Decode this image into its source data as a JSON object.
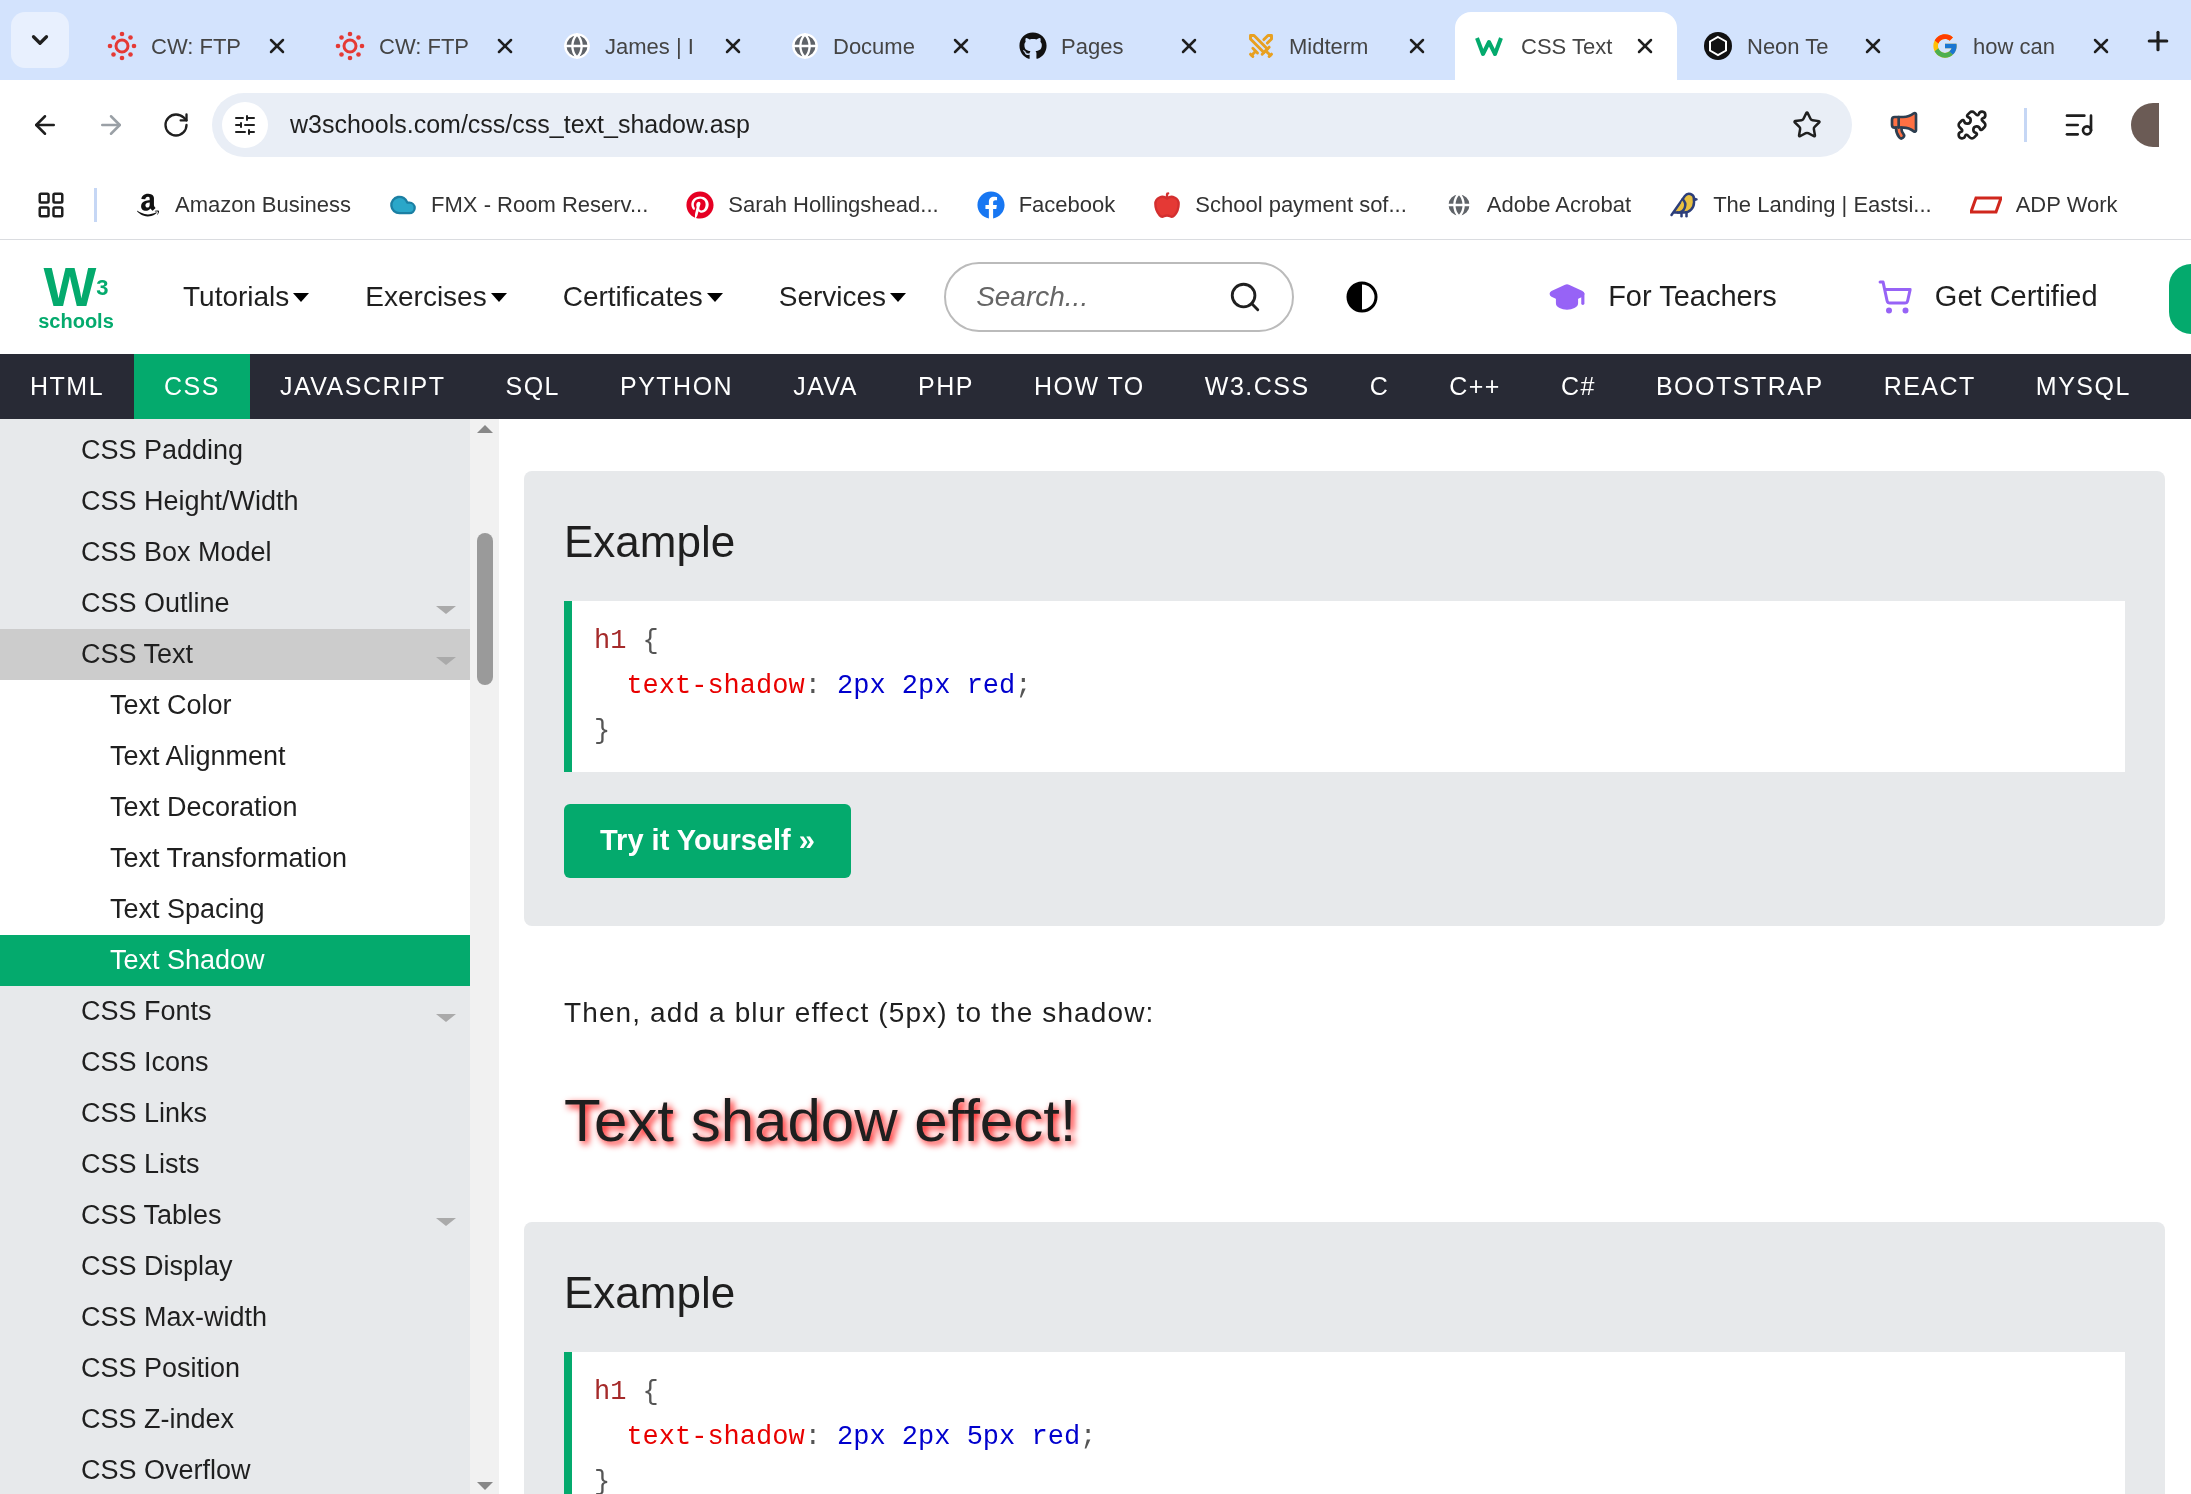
{
  "browser": {
    "tabs": [
      {
        "title": "CW: FTP",
        "kind": "canvas",
        "selected": false
      },
      {
        "title": "CW: FTP",
        "kind": "canvas",
        "selected": false
      },
      {
        "title": "James | I",
        "kind": "globe",
        "selected": false
      },
      {
        "title": "Docume",
        "kind": "globe",
        "selected": false
      },
      {
        "title": "Pages",
        "kind": "github",
        "selected": false
      },
      {
        "title": "Midterm",
        "kind": "swords",
        "selected": false
      },
      {
        "title": "CSS Text",
        "kind": "w3",
        "selected": true
      },
      {
        "title": "Neon Te",
        "kind": "openai",
        "selected": false
      },
      {
        "title": "how can",
        "kind": "google",
        "selected": false
      }
    ],
    "address": "w3schools.com/css/css_text_shadow.asp",
    "bookmarks": [
      {
        "label": "Amazon Business",
        "kind": "amazon"
      },
      {
        "label": "FMX - Room Reserv...",
        "kind": "cloud"
      },
      {
        "label": "Sarah Hollingshead...",
        "kind": "pinterest"
      },
      {
        "label": "Facebook",
        "kind": "facebook"
      },
      {
        "label": "School payment sof...",
        "kind": "apple"
      },
      {
        "label": "Adobe Acrobat",
        "kind": "globe"
      },
      {
        "label": "The Landing | Eastsi...",
        "kind": "bird"
      },
      {
        "label": "ADP Work",
        "kind": "adp"
      }
    ]
  },
  "header": {
    "logo": {
      "mark": "W",
      "sup": "3",
      "text": "schools"
    },
    "menus": [
      "Tutorials",
      "Exercises",
      "Certificates",
      "Services"
    ],
    "search": {
      "placeholder": "Search..."
    },
    "links": [
      {
        "label": "For Teachers",
        "kind": "cap"
      },
      {
        "label": "Get Certified",
        "kind": "cart"
      }
    ]
  },
  "topnav": [
    {
      "label": "HTML",
      "selected": false
    },
    {
      "label": "CSS",
      "selected": true
    },
    {
      "label": "JAVASCRIPT",
      "selected": false
    },
    {
      "label": "SQL",
      "selected": false
    },
    {
      "label": "PYTHON",
      "selected": false
    },
    {
      "label": "JAVA",
      "selected": false
    },
    {
      "label": "PHP",
      "selected": false
    },
    {
      "label": "HOW TO",
      "selected": false
    },
    {
      "label": "W3.CSS",
      "selected": false
    },
    {
      "label": "C",
      "selected": false
    },
    {
      "label": "C++",
      "selected": false
    },
    {
      "label": "C#",
      "selected": false
    },
    {
      "label": "BOOTSTRAP",
      "selected": false
    },
    {
      "label": "REACT",
      "selected": false
    },
    {
      "label": "MYSQL",
      "selected": false
    }
  ],
  "sidebar": {
    "items": [
      {
        "label": "CSS Padding",
        "submenu": false,
        "expanded": false,
        "selected": false
      },
      {
        "label": "CSS Height/Width",
        "submenu": false,
        "expanded": false,
        "selected": false
      },
      {
        "label": "CSS Box Model",
        "submenu": false,
        "expanded": false,
        "selected": false
      },
      {
        "label": "CSS Outline",
        "submenu": true,
        "expanded": false,
        "selected": false
      },
      {
        "label": "CSS Text",
        "submenu": true,
        "expanded": true,
        "selected": false,
        "children": [
          {
            "label": "Text Color",
            "selected": false
          },
          {
            "label": "Text Alignment",
            "selected": false
          },
          {
            "label": "Text Decoration",
            "selected": false
          },
          {
            "label": "Text Transformation",
            "selected": false
          },
          {
            "label": "Text Spacing",
            "selected": false
          },
          {
            "label": "Text Shadow",
            "selected": true
          }
        ]
      },
      {
        "label": "CSS Fonts",
        "submenu": true,
        "expanded": false,
        "selected": false
      },
      {
        "label": "CSS Icons",
        "submenu": false,
        "expanded": false,
        "selected": false
      },
      {
        "label": "CSS Links",
        "submenu": false,
        "expanded": false,
        "selected": false
      },
      {
        "label": "CSS Lists",
        "submenu": false,
        "expanded": false,
        "selected": false
      },
      {
        "label": "CSS Tables",
        "submenu": true,
        "expanded": false,
        "selected": false
      },
      {
        "label": "CSS Display",
        "submenu": false,
        "expanded": false,
        "selected": false
      },
      {
        "label": "CSS Max-width",
        "submenu": false,
        "expanded": false,
        "selected": false
      },
      {
        "label": "CSS Position",
        "submenu": false,
        "expanded": false,
        "selected": false
      },
      {
        "label": "CSS Z-index",
        "submenu": false,
        "expanded": false,
        "selected": false
      },
      {
        "label": "CSS Overflow",
        "submenu": false,
        "expanded": false,
        "selected": false
      }
    ]
  },
  "content": [
    {
      "kind": "example",
      "title": "Example",
      "code": [
        [
          {
            "t": "h1",
            "kind": "selector"
          },
          {
            "t": " {",
            "kind": "punct"
          }
        ],
        [
          {
            "t": "  text-shadow",
            "kind": "property"
          },
          {
            "t": ":",
            "kind": "punct"
          },
          {
            "t": " 2px 2px red",
            "kind": "value"
          },
          {
            "t": ";",
            "kind": "punct"
          }
        ],
        [
          {
            "t": "}",
            "kind": "punct"
          }
        ]
      ],
      "button": "Try it Yourself »"
    },
    {
      "kind": "paragraph",
      "text": "Then, add a blur effect (5px) to the shadow:"
    },
    {
      "kind": "demo",
      "text": "Text shadow effect!"
    },
    {
      "kind": "example",
      "title": "Example",
      "code": [
        [
          {
            "t": "h1",
            "kind": "selector"
          },
          {
            "t": " {",
            "kind": "punct"
          }
        ],
        [
          {
            "t": "  text-shadow",
            "kind": "property"
          },
          {
            "t": ":",
            "kind": "punct"
          },
          {
            "t": " 2px 2px 5px red",
            "kind": "value"
          },
          {
            "t": ";",
            "kind": "punct"
          }
        ],
        [
          {
            "t": "}",
            "kind": "punct"
          }
        ]
      ]
    }
  ]
}
